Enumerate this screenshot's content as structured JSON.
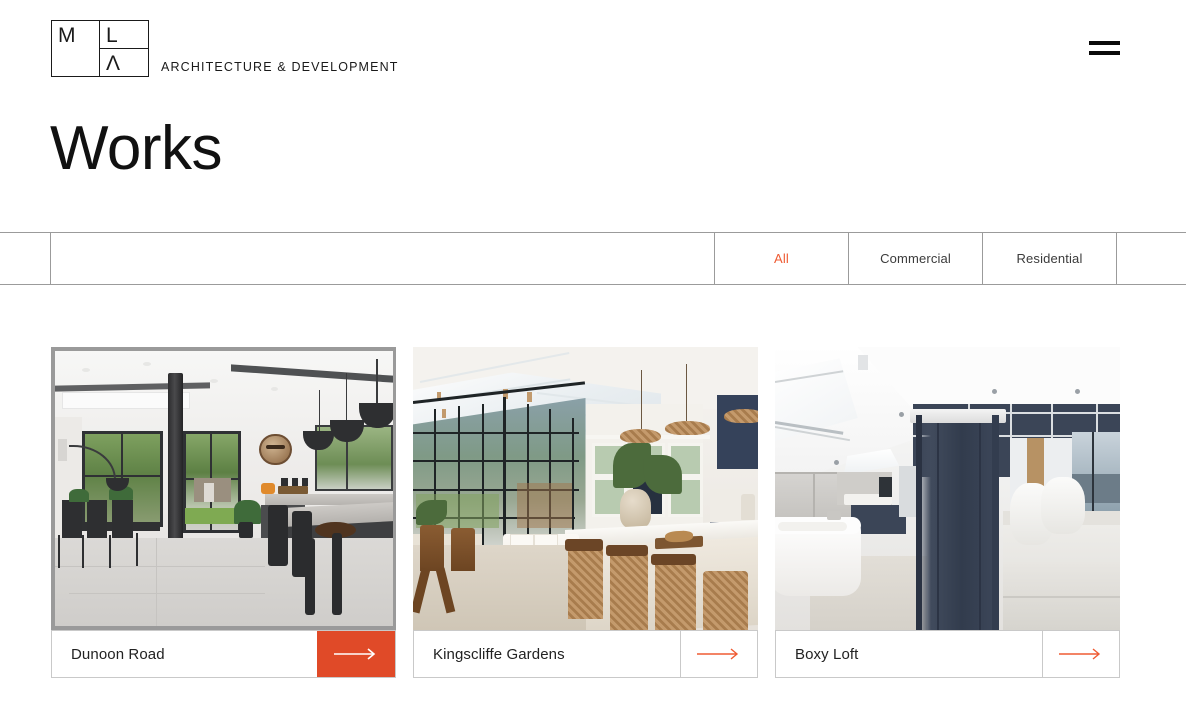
{
  "header": {
    "logo": {
      "letter_m": "M",
      "letter_l": "L",
      "letter_a": "Λ",
      "icon_name": "mla-monogram-logo"
    },
    "brand_tagline": "ARCHITECTURE & DEVELOPMENT",
    "menu_icon": "hamburger-menu-icon"
  },
  "page": {
    "title": "Works"
  },
  "filters": {
    "tabs": [
      {
        "label": "All",
        "active": true
      },
      {
        "label": "Commercial",
        "active": false
      },
      {
        "label": "Residential",
        "active": false
      }
    ]
  },
  "works": [
    {
      "title": "Dunoon Road",
      "arrow_icon": "arrow-right-icon",
      "arrow_style": "filled",
      "image_alt": "Open-plan kitchen and dining extension with black sliding doors, steel column and pendant lights"
    },
    {
      "title": "Kingscliffe Gardens",
      "arrow_icon": "arrow-right-icon",
      "arrow_style": "outline",
      "image_alt": "Garden room with gabled crittall glazing, marble island, rattan pendants and green shelving"
    },
    {
      "title": "Boxy Loft",
      "arrow_icon": "arrow-right-icon",
      "arrow_style": "outline",
      "image_alt": "Loft conversion with navy blue partition, freestanding bath, skylight and bedroom beyond"
    }
  ],
  "colors": {
    "accent": "#ef5b33",
    "accent_button": "#e04a28",
    "text_dark": "#222222",
    "rule": "#9b9b9b",
    "card_border": "#c9c9c9"
  }
}
